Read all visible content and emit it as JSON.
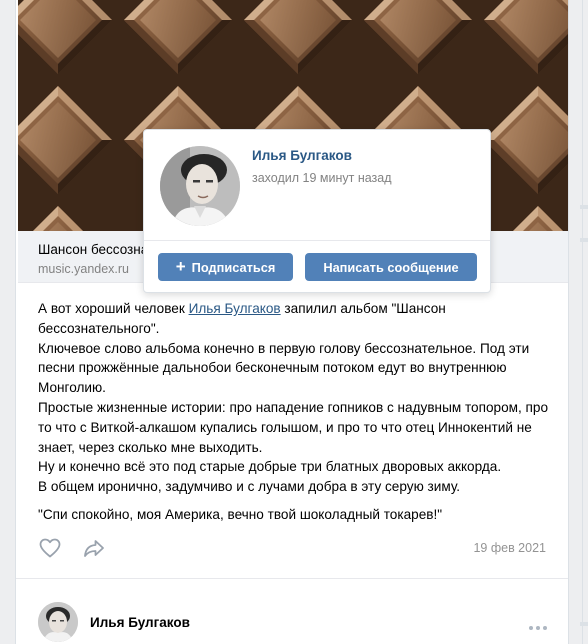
{
  "link": {
    "title": "Шансон бессознательного",
    "domain": "music.yandex.ru"
  },
  "post": {
    "line1_before": "А вот хороший человек ",
    "mention": "Илья Булгаков",
    "line1_after": " запилил альбом \"Шансон бессознательного\".",
    "line2": "Ключевое слово альбома конечно в первую голову бессознательное. Под эти песни прожжённые дальнобои бесконечным потоком едут во внутреннюю Монголию.",
    "line3": "Простые жизненные истории: про нападение гопников с надувным топором, про то что с Виткой-алкашом купались голышом, и про то что отец Иннокентий не знает, через сколько мне выходить.",
    "line4": "Ну и конечно всё это под старые добрые три блатных дворовых аккорда.",
    "line5": "В общем иронично, задумчиво и с лучами добра в эту серую зиму.",
    "quote": "\"Спи спокойно, моя Америка, вечно твой шоколадный токарев!\"",
    "date": "19 фев 2021"
  },
  "author": {
    "name": "Илья Булгаков"
  },
  "popup": {
    "name": "Илья Булгаков",
    "status": "заходил 19 минут назад",
    "subscribe_label": "Подписаться",
    "message_label": "Написать сообщение"
  },
  "icons": {
    "like": "heart-icon",
    "share": "share-icon",
    "more": "more-dots-icon",
    "plus": "plus-icon"
  },
  "colors": {
    "accent": "#5181b8",
    "link": "#2a5885",
    "muted": "#828282",
    "background": "#edeef0"
  }
}
